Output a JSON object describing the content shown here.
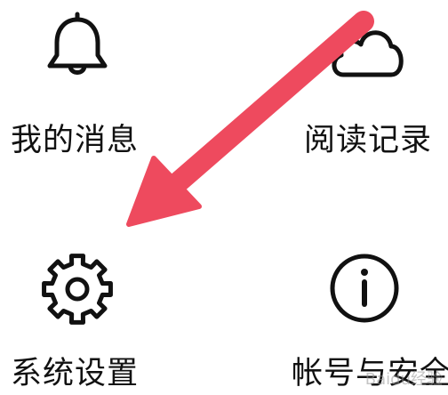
{
  "menu": {
    "items": [
      {
        "label": "我的消息",
        "icon": "bell-icon"
      },
      {
        "label": "阅读记录",
        "icon": "cloud-icon"
      },
      {
        "label": "系统设置",
        "icon": "gear-icon"
      },
      {
        "label": "帐号与安全",
        "icon": "info-icon"
      }
    ]
  },
  "annotation": {
    "arrow_color": "#ee4a5e",
    "watermark_text": "Baidu经验"
  },
  "colors": {
    "icon_stroke": "#111111",
    "background": "#ffffff"
  }
}
